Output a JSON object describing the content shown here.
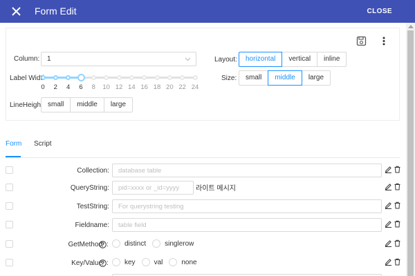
{
  "appbar": {
    "title": "Form Edit",
    "close_label": "CLOSE",
    "close_icon": "close-icon",
    "background": "#3f51b5"
  },
  "toolbar": {
    "save_icon": "save-icon",
    "more_icon": "more-vert-icon"
  },
  "settings": {
    "column": {
      "label": "Column:",
      "value": "1"
    },
    "layout": {
      "label": "Layout:",
      "options": [
        "horizontal",
        "vertical",
        "inline"
      ],
      "selected": "horizontal"
    },
    "label_width": {
      "label": "Label Widtl",
      "marks": [
        "0",
        "2",
        "4",
        "6",
        "8",
        "10",
        "12",
        "14",
        "16",
        "18",
        "20",
        "22",
        "24"
      ],
      "value": 6,
      "min": 0,
      "max": 24
    },
    "size": {
      "label": "Size:",
      "options": [
        "small",
        "middle",
        "large"
      ],
      "selected": "middle"
    },
    "line_height": {
      "label": "LineHeight",
      "options": [
        "small",
        "middle",
        "large"
      ]
    }
  },
  "tabs": [
    {
      "label": "Form",
      "active": true
    },
    {
      "label": "Script",
      "active": false
    }
  ],
  "fields": [
    {
      "label": "Collection",
      "type": "input",
      "placeholder": "database table",
      "help": false
    },
    {
      "label": "QueryString",
      "type": "input",
      "placeholder": "pid=xxxx or _id=yyyy",
      "note": "라이트 메시지",
      "help": false
    },
    {
      "label": "TestString",
      "type": "input",
      "placeholder": "For querystring testing",
      "help": false
    },
    {
      "label": "Fieldname",
      "type": "input",
      "placeholder": "table field",
      "help": false
    },
    {
      "label": "GetMethod",
      "type": "radio",
      "options": [
        "distinct",
        "singlerow"
      ],
      "help": true
    },
    {
      "label": "Key/Value",
      "type": "radio",
      "options": [
        "key",
        "val",
        "none"
      ],
      "help": true
    }
  ],
  "colors": {
    "accent": "#1890ff",
    "border": "#d9d9d9",
    "slider_track": "#91d5ff"
  }
}
